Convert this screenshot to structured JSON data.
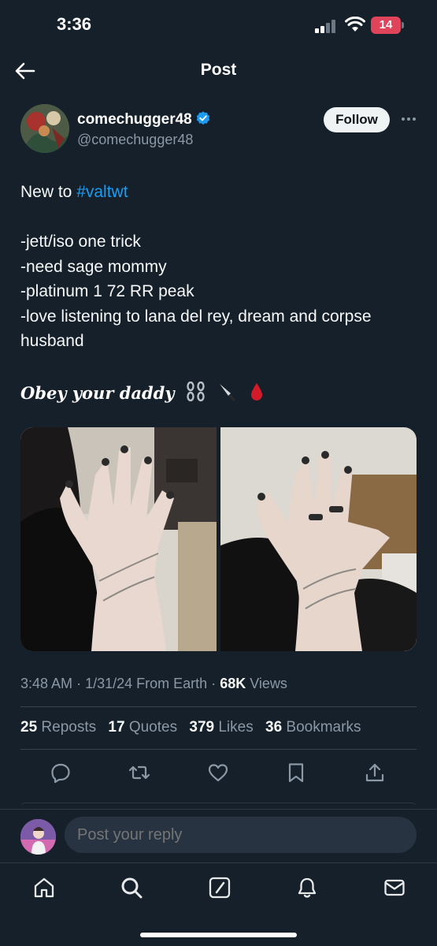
{
  "status_bar": {
    "time": "3:36",
    "battery": "14"
  },
  "nav": {
    "title": "Post"
  },
  "author": {
    "display_name": "comechugger48",
    "handle": "@comechugger48",
    "verified": true,
    "follow_label": "Follow"
  },
  "post": {
    "intro": "New to ",
    "hashtag": "#valtwt",
    "lines": [
      "-jett/iso one trick",
      "-need sage mommy",
      "-platinum 1 72 RR peak",
      "-love listening to lana del rey, dream and corpse",
      "husband"
    ],
    "styled_line": "Obey your daddy",
    "emojis": [
      "chains-emoji",
      "knife-emoji",
      "blood-drop-emoji"
    ],
    "media_count": 2
  },
  "meta": {
    "time": "3:48 AM",
    "date": "1/31/24",
    "source": "From Earth",
    "views_count": "68K",
    "views_label": "Views"
  },
  "stats": [
    {
      "count": "25",
      "label": "Reposts"
    },
    {
      "count": "17",
      "label": "Quotes"
    },
    {
      "count": "379",
      "label": "Likes"
    },
    {
      "count": "36",
      "label": "Bookmarks"
    }
  ],
  "actions": [
    "reply-icon",
    "repost-icon",
    "like-icon",
    "bookmark-icon",
    "share-icon"
  ],
  "reply": {
    "placeholder": "Post your reply"
  },
  "tabs": [
    "home-icon",
    "search-icon",
    "grok-icon",
    "notifications-icon",
    "messages-icon"
  ],
  "colors": {
    "background": "#15202b",
    "accent": "#1d9bf0",
    "secondary_text": "#8b98a5",
    "divider": "#38444d",
    "battery_low": "#e0445a"
  }
}
